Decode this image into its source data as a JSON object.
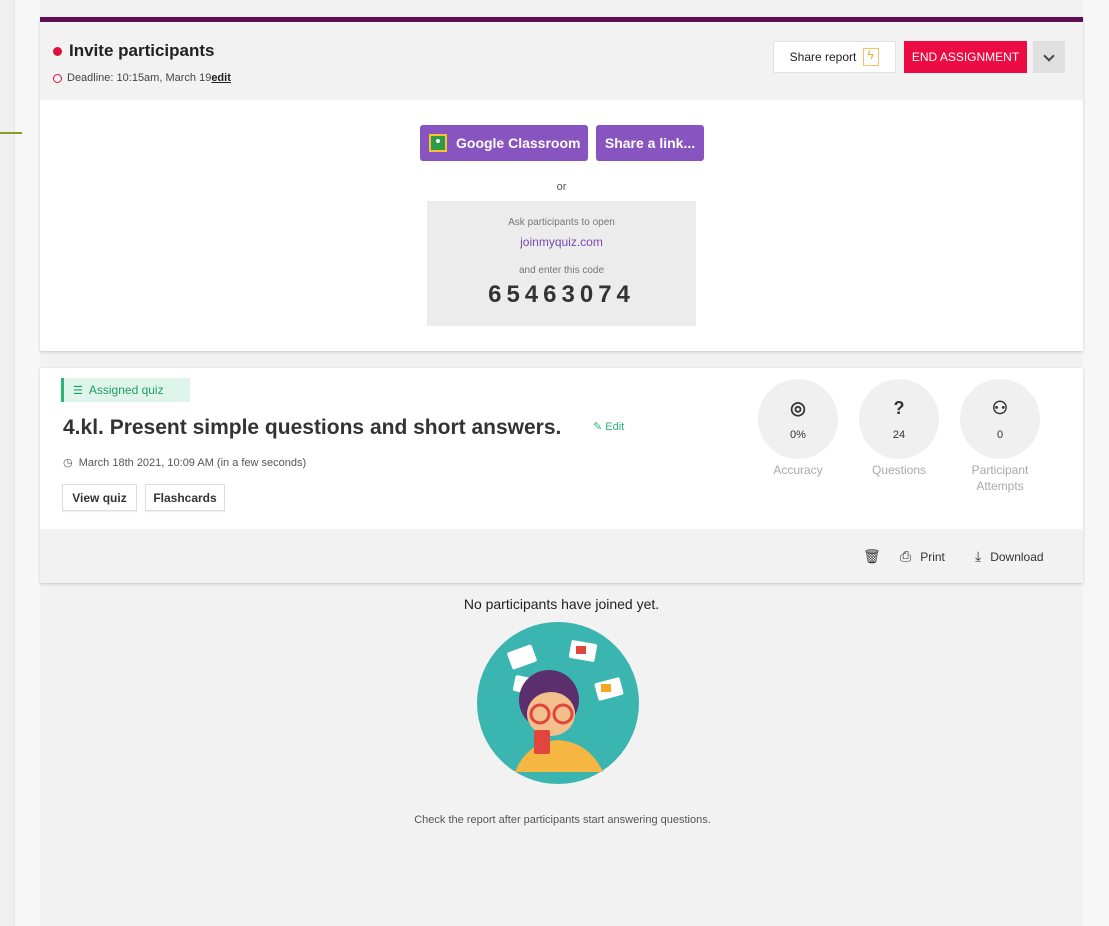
{
  "invite": {
    "title": "Invite participants",
    "deadline_label": "Deadline: 10:15am, March 19",
    "edit_link": "edit",
    "share_report": "Share report",
    "end_assignment": "END ASSIGNMENT",
    "google_classroom": "Google Classroom",
    "share_link": "Share a link...",
    "or": "or",
    "ask": "Ask participants to open",
    "site": "joinmyquiz.com",
    "enter": "and enter this code",
    "code": "65463074"
  },
  "quiz": {
    "badge": "Assigned quiz",
    "title": "4.kl. Present simple questions and short answers.",
    "edit": "Edit",
    "date": "March 18th 2021, 10:09 AM (in a few seconds)",
    "view_quiz": "View quiz",
    "flashcards": "Flashcards",
    "stats": [
      {
        "icon": "target-icon",
        "value": "0%",
        "label": "Accuracy"
      },
      {
        "icon": "question-icon",
        "value": "24",
        "label": "Questions"
      },
      {
        "icon": "participants-icon",
        "value": "0",
        "label": "Participant Attempts"
      }
    ],
    "print": "Print",
    "download": "Download"
  },
  "empty_state": {
    "title": "No participants have joined yet.",
    "subtitle": "Check the report after participants start answering questions."
  },
  "colors": {
    "accent_purple": "#8854c0",
    "danger": "#ec0b43",
    "top_border": "#5c1053",
    "green": "#2bb673"
  }
}
